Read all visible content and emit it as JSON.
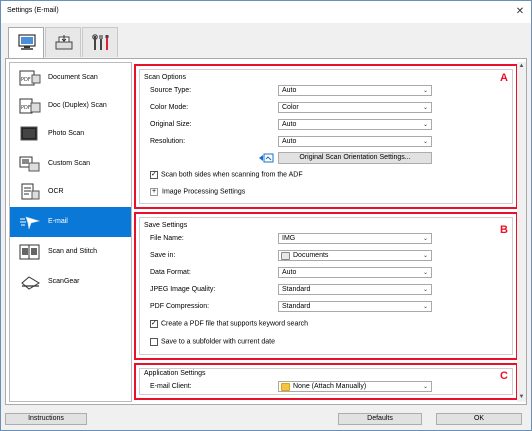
{
  "window": {
    "title": "Settings (E-mail)",
    "close_glyph": "✕"
  },
  "top_tabs": [
    {
      "icon": "scan-from-computer-icon"
    },
    {
      "icon": "scan-from-panel-icon"
    },
    {
      "icon": "general-settings-icon"
    }
  ],
  "sidebar": {
    "items": [
      {
        "label": "Document Scan",
        "icon": "document-scan-icon"
      },
      {
        "label": "Doc (Duplex) Scan",
        "icon": "duplex-scan-icon"
      },
      {
        "label": "Photo Scan",
        "icon": "photo-scan-icon"
      },
      {
        "label": "Custom Scan",
        "icon": "custom-scan-icon"
      },
      {
        "label": "OCR",
        "icon": "ocr-icon"
      },
      {
        "label": "E-mail",
        "icon": "email-icon",
        "selected": true
      },
      {
        "label": "Scan and Stitch",
        "icon": "stitch-icon"
      },
      {
        "label": "ScanGear",
        "icon": "scangear-icon"
      }
    ]
  },
  "scan_options": {
    "title": "Scan Options",
    "marker": "A",
    "source_type": {
      "label": "Source Type:",
      "value": "Auto"
    },
    "color_mode": {
      "label": "Color Mode:",
      "value": "Color"
    },
    "original_size": {
      "label": "Original Size:",
      "value": "Auto"
    },
    "resolution": {
      "label": "Resolution:",
      "value": "Auto"
    },
    "orientation_button": "Original Scan Orientation Settings...",
    "scan_both_sides": {
      "label": "Scan both sides when scanning from the ADF",
      "checked": true
    },
    "image_processing": {
      "label": "Image Processing Settings",
      "expander": "+"
    }
  },
  "save_settings": {
    "title": "Save Settings",
    "marker": "B",
    "file_name": {
      "label": "File Name:",
      "value": "IMG"
    },
    "save_in": {
      "label": "Save in:",
      "value": "Documents"
    },
    "data_format": {
      "label": "Data Format:",
      "value": "Auto"
    },
    "jpeg_quality": {
      "label": "JPEG Image Quality:",
      "value": "Standard"
    },
    "pdf_compression": {
      "label": "PDF Compression:",
      "value": "Standard"
    },
    "keyword_pdf": {
      "label": "Create a PDF file that supports keyword search",
      "checked": true
    },
    "subfolder": {
      "label": "Save to a subfolder with current date",
      "checked": false
    }
  },
  "application_settings": {
    "title": "Application Settings",
    "marker": "C",
    "email_client": {
      "label": "E-mail Client:",
      "value": "None (Attach Manually)"
    }
  },
  "footer": {
    "instructions": "Instructions",
    "defaults": "Defaults",
    "ok": "OK"
  },
  "dropdown_glyph": "⌄",
  "colors": {
    "selection": "#0a78d7",
    "highlight": "#e8102a"
  }
}
